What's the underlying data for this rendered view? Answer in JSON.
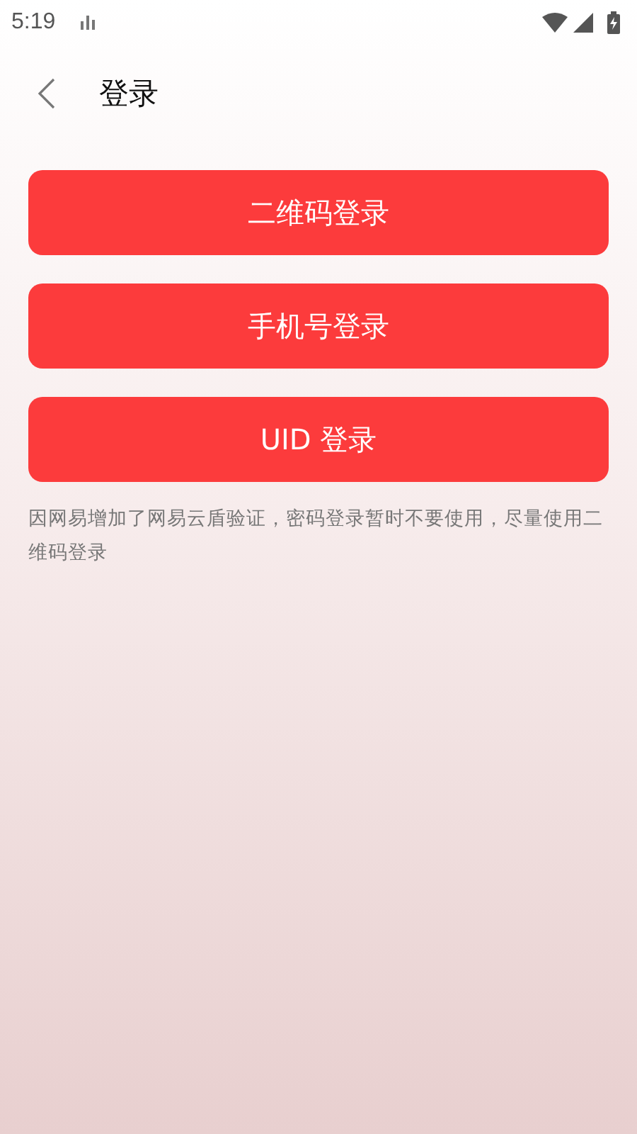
{
  "status_bar": {
    "time": "5:19"
  },
  "header": {
    "title": "登录"
  },
  "buttons": [
    {
      "label": "二维码登录"
    },
    {
      "label": "手机号登录"
    },
    {
      "label": "UID 登录"
    }
  ],
  "note": "因网易增加了网易云盾验证，密码登录暂时不要使用，尽量使用二维码登录"
}
